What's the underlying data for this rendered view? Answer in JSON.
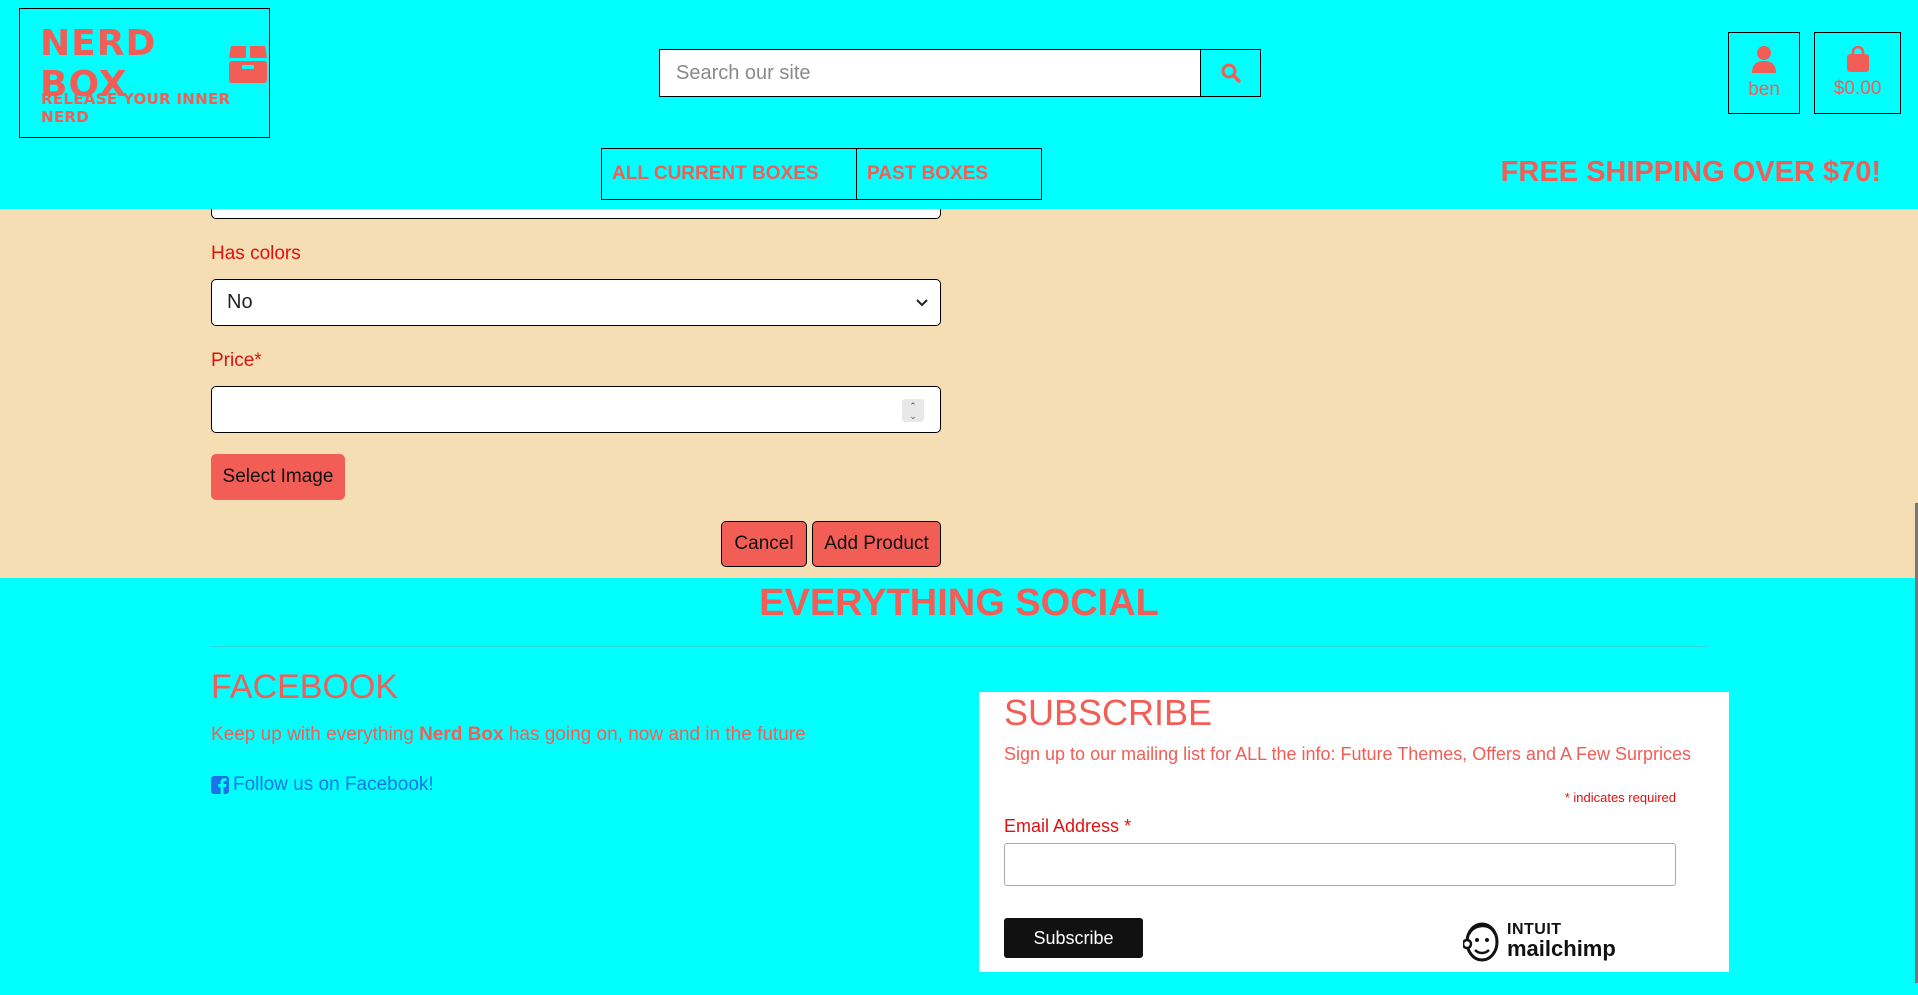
{
  "colors": {
    "header_bg": "#00ffff",
    "accent": "#f25d55",
    "page_bg": "#f5deb3",
    "label_red": "#e01010",
    "link_blue": "#1a73e8"
  },
  "header": {
    "logo_title": "NERD BOX",
    "logo_subtitle": "RELEASE YOUR INNER NERD",
    "search_placeholder": "Search our site",
    "user_label": "ben",
    "cart_label": "$0.00",
    "nav": [
      {
        "label": "ALL CURRENT BOXES"
      },
      {
        "label": "PAST BOXES"
      }
    ],
    "shipping_text": "FREE SHIPPING OVER $70!"
  },
  "form": {
    "has_colors_label": "Has colors",
    "has_colors_value": "No",
    "price_label": "Price*",
    "select_image_label": "Select Image",
    "cancel_label": "Cancel",
    "add_product_label": "Add Product"
  },
  "footer": {
    "social_title": "EVERYTHING SOCIAL",
    "facebook": {
      "title": "FACEBOOK",
      "text_before": "Keep up with everything ",
      "text_bold": "Nerd Box",
      "text_after": " has going on, now and in the future",
      "link": "Follow us on Facebook!"
    },
    "subscribe": {
      "title": "SUBSCRIBE",
      "text": "Sign up to our mailing list for ALL the info: Future Themes, Offers and A Few Surprices",
      "required_star": "*",
      "required_note": " indicates required",
      "email_label": "Email Address",
      "email_star": "*",
      "button": "Subscribe",
      "brand_top": "INTUIT",
      "brand_bottom": "mailchimp"
    }
  }
}
